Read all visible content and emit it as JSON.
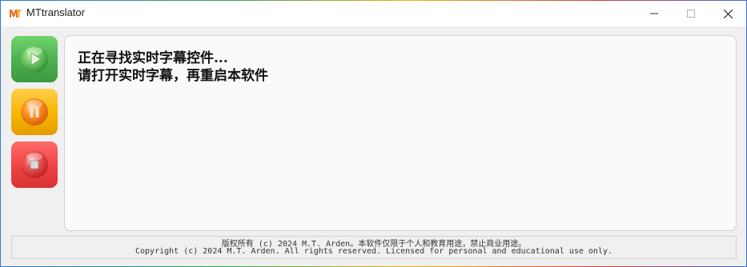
{
  "window": {
    "title": "MTtranslator",
    "icon": "mt-logo-icon",
    "controls": [
      "minimize-icon",
      "maximize-icon",
      "close-icon"
    ]
  },
  "controls": {
    "play": {
      "icon": "play-icon",
      "color": "#4caf50"
    },
    "pause": {
      "icon": "pause-icon",
      "color": "#f7b500"
    },
    "stop": {
      "icon": "stop-icon",
      "color": "#ef4343"
    }
  },
  "status": {
    "line1": "正在寻找实时字幕控件...",
    "line2": "请打开实时字幕，再重启本软件"
  },
  "footer": {
    "line1": "版权所有 (c) 2024 M.T. Arden。本软件仅限于个人和教育用途，禁止商业用途。",
    "line2": "Copyright (c) 2024 M.T. Arden. All rights reserved. Licensed for personal and educational use only."
  }
}
